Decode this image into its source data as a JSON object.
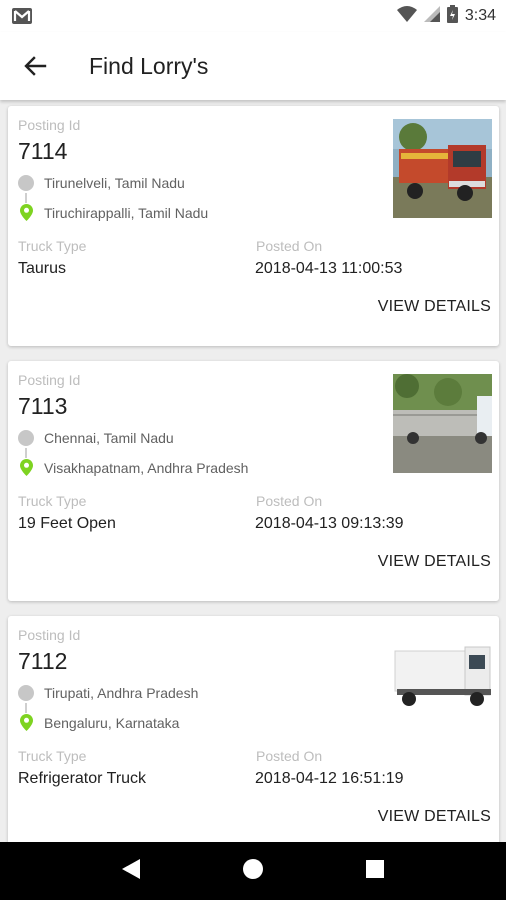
{
  "status_bar": {
    "time": "3:34"
  },
  "app_bar": {
    "title": "Find Lorry's"
  },
  "labels": {
    "posting_id": "Posting Id",
    "truck_type": "Truck Type",
    "posted_on": "Posted On",
    "view_details": "VIEW DETAILS"
  },
  "postings": [
    {
      "id": "7114",
      "from": "Tirunelveli, Tamil Nadu",
      "to": "Tiruchirappalli, Tamil Nadu",
      "truck_type": "Taurus",
      "posted_on": "2018-04-13 11:00:53"
    },
    {
      "id": "7113",
      "from": "Chennai, Tamil Nadu",
      "to": "Visakhapatnam, Andhra Pradesh",
      "truck_type": "19 Feet Open",
      "posted_on": "2018-04-13 09:13:39"
    },
    {
      "id": "7112",
      "from": "Tirupati, Andhra Pradesh",
      "to": "Bengaluru, Karnataka",
      "truck_type": "Refrigerator Truck",
      "posted_on": "2018-04-12 16:51:19"
    }
  ],
  "colors": {
    "pin": "#7ed321",
    "origin_dot": "#c7c7c7",
    "label": "#bdbdbd",
    "nav_bar": "#000000"
  }
}
